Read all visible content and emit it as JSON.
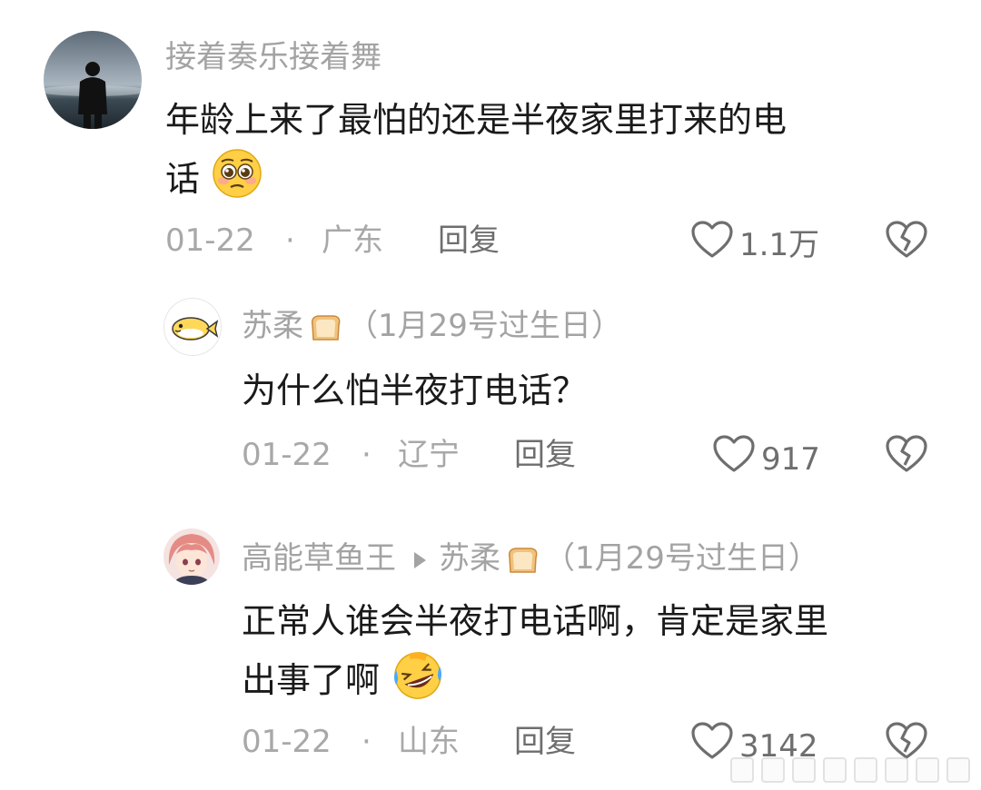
{
  "comments": [
    {
      "author": "接着奏乐接着舞",
      "text_line1": "年龄上来了最怕的还是半夜家里打来的电",
      "text_line2": "话",
      "date": "01-22",
      "sep": "·",
      "location": "广东",
      "reply_label": "回复",
      "likes": "1.1万",
      "avatar_icon": "silhouette-avatar",
      "emoji_icon": "pleading-face-icon"
    },
    {
      "author": "苏柔",
      "author_suffix": "（1月29号过生日）",
      "text": "为什么怕半夜打电话？",
      "date": "01-22",
      "sep": "·",
      "location": "辽宁",
      "reply_label": "回复",
      "likes": "917",
      "avatar_icon": "fish-avatar"
    },
    {
      "author": "高能草鱼王",
      "reply_to": "苏柔",
      "reply_to_suffix": "（1月29号过生日）",
      "text_line1": "正常人谁会半夜打电话啊，肯定是家里",
      "text_line2": "出事了啊",
      "date": "01-22",
      "sep": "·",
      "location": "山东",
      "reply_label": "回复",
      "likes": "3142",
      "avatar_icon": "anime-avatar",
      "emoji_icon": "rofl-face-icon"
    }
  ],
  "colors": {
    "name": "#a3a3a3",
    "content": "#1a1a1a",
    "meta": "#a8a8a8",
    "action": "#6e6e6e"
  }
}
